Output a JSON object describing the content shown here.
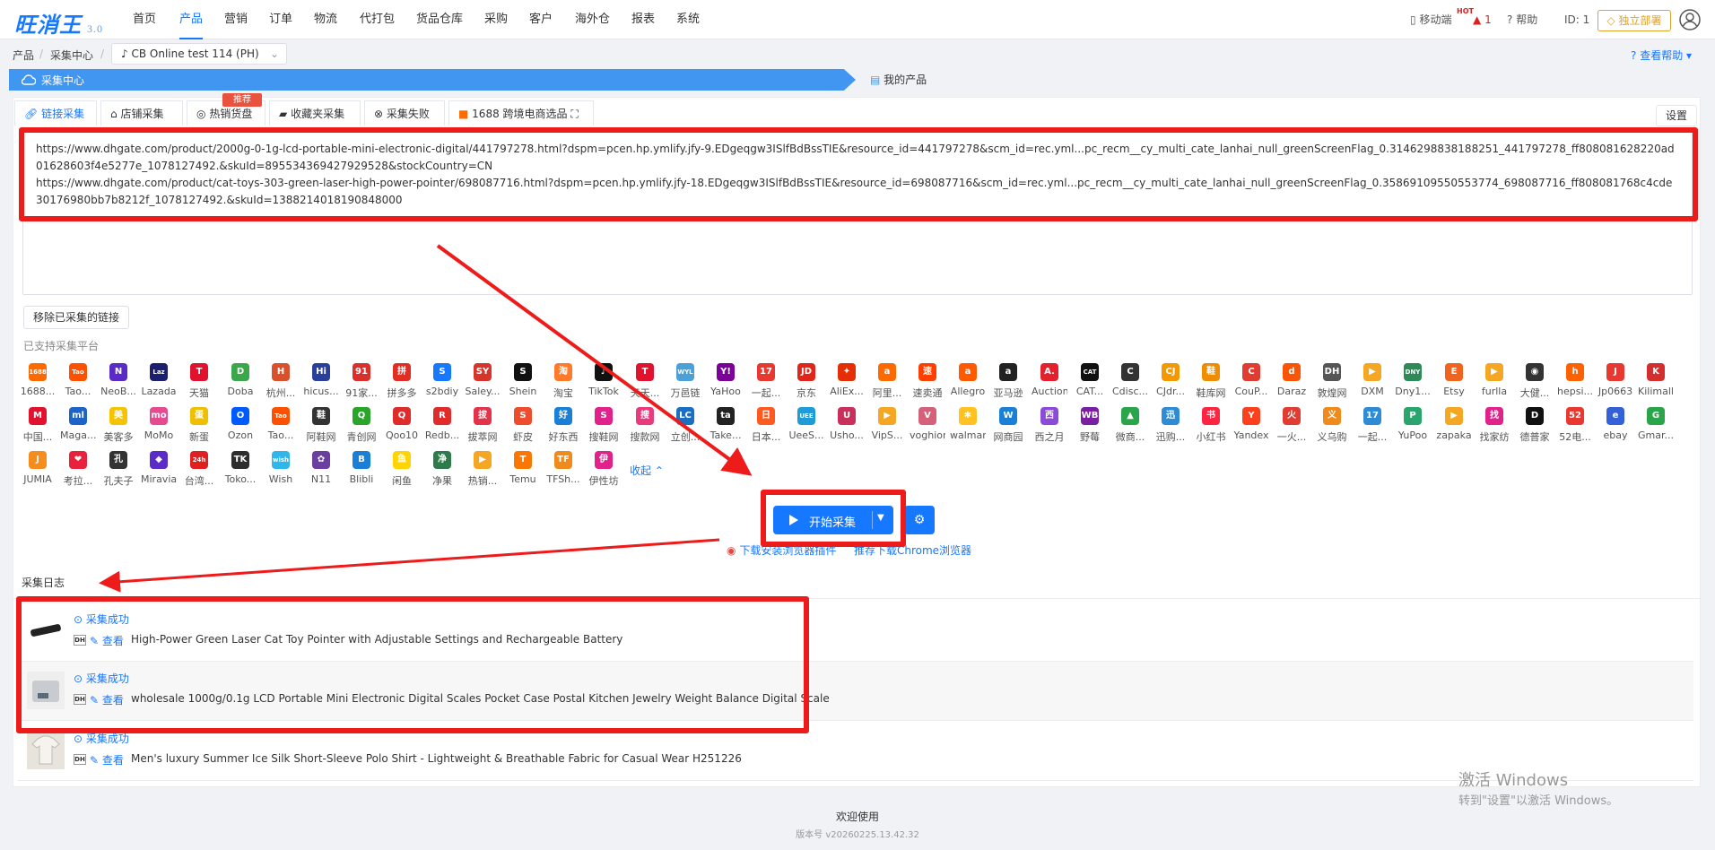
{
  "app": {
    "logo": "旺消王",
    "version": "3.0"
  },
  "nav": [
    "首页",
    "产品",
    "营销",
    "订单",
    "物流",
    "代打包",
    "货品仓库",
    "采购",
    "客户",
    "海外仓",
    "报表",
    "系统"
  ],
  "nav_active": 1,
  "topright": {
    "mobile": "移动端",
    "hot": "HOT",
    "alert_count": "1",
    "help": "帮助",
    "id": "ID: 1",
    "deploy": "独立部署"
  },
  "breadcrumb": {
    "product": "产品",
    "center": "采集中心",
    "store": "CB Online test 114 (PH)",
    "help": "查看帮助"
  },
  "bar": {
    "collect_center": "采集中心",
    "my_products": "我的产品"
  },
  "tabs": [
    "链接采集",
    "店铺采集",
    "热销货盘",
    "收藏夹采集",
    "采集失败",
    "1688 跨境电商选品"
  ],
  "tab_badge": "推荐",
  "settings": "设置",
  "urls": [
    "https://www.dhgate.com/product/2000g-0-1g-lcd-portable-mini-electronic-digital/441797278.html?dspm=pcen.hp.ymlify.jfy-9.EDgeqgw3ISlfBdBssTIE&resource_id=441797278&scm_id=rec.yml...pc_recm__cy_multi_cate_lanhai_null_greenScreenFlag_0.3146298838188251_441797278_ff808081628220ad01628603f4e5277e_1078127492.&skuId=895534369427929528&stockCountry=CN",
    "https://www.dhgate.com/product/cat-toys-303-green-laser-high-power-pointer/698087716.html?dspm=pcen.hp.ymlify.jfy-18.EDgeqgw3ISlfBdBssTIE&resource_id=698087716&scm_id=rec.yml...pc_recm__cy_multi_cate_lanhai_null_greenScreenFlag_0.35869109550553774_698087716_ff808081768c4cde30176980bb7b8212f_1078127492.&skuId=1388214018190848000"
  ],
  "remove_btn": "移除已采集的链接",
  "supported_label": "已支持采集平台",
  "platforms": [
    {
      "name": "1688...",
      "color": "#ff6a00",
      "glyph": "1688"
    },
    {
      "name": "Tao...",
      "color": "#ff5000",
      "glyph": "Tao"
    },
    {
      "name": "NeoB...",
      "color": "#5b2bc7",
      "glyph": "N"
    },
    {
      "name": "Lazada",
      "color": "#1c1f6e",
      "glyph": "Laz"
    },
    {
      "name": "天猫",
      "color": "#e0122d",
      "glyph": "T"
    },
    {
      "name": "Doba",
      "color": "#3aa84a",
      "glyph": "D"
    },
    {
      "name": "杭州...",
      "color": "#d9512c",
      "glyph": "H"
    },
    {
      "name": "hicus...",
      "color": "#2a3f9b",
      "glyph": "Hi"
    },
    {
      "name": "91家...",
      "color": "#d9302c",
      "glyph": "91"
    },
    {
      "name": "拼多多",
      "color": "#e02e24",
      "glyph": "拼"
    },
    {
      "name": "s2bdiy",
      "color": "#1677ff",
      "glyph": "S"
    },
    {
      "name": "Saley...",
      "color": "#d8352a",
      "glyph": "SY"
    },
    {
      "name": "Shein",
      "color": "#111111",
      "glyph": "S"
    },
    {
      "name": "淘宝",
      "color": "#ff7a2a",
      "glyph": "淘"
    },
    {
      "name": "TikTok",
      "color": "#111111",
      "glyph": "♪"
    },
    {
      "name": "天天...",
      "color": "#e0122d",
      "glyph": "T"
    },
    {
      "name": "万邑链",
      "color": "#4ca0d8",
      "glyph": "WYL"
    },
    {
      "name": "YaHoo",
      "color": "#7b0099",
      "glyph": "Y!"
    },
    {
      "name": "一起...",
      "color": "#e8382f",
      "glyph": "17"
    },
    {
      "name": "京东",
      "color": "#e1251b",
      "glyph": "JD"
    },
    {
      "name": "AliEx...",
      "color": "#e62e04",
      "glyph": "✦"
    },
    {
      "name": "阿里...",
      "color": "#ff6a00",
      "glyph": "a"
    },
    {
      "name": "速卖通",
      "color": "#ff4000",
      "glyph": "速"
    },
    {
      "name": "Allegro",
      "color": "#ff5a00",
      "glyph": "a"
    },
    {
      "name": "亚马逊",
      "color": "#222222",
      "glyph": "a"
    },
    {
      "name": "Auction",
      "color": "#e3202b",
      "glyph": "A."
    },
    {
      "name": "CAT...",
      "color": "#111111",
      "glyph": "CAT"
    },
    {
      "name": "Cdisc...",
      "color": "#333333",
      "glyph": "C"
    },
    {
      "name": "CJdr...",
      "color": "#f39800",
      "glyph": "CJ"
    },
    {
      "name": "鞋库网",
      "color": "#f08c00",
      "glyph": "鞋"
    },
    {
      "name": "CouP...",
      "color": "#e03c31",
      "glyph": "C"
    },
    {
      "name": "Daraz",
      "color": "#f85606",
      "glyph": "d"
    },
    {
      "name": "敦煌网",
      "color": "#555555",
      "glyph": "DH"
    },
    {
      "name": "DXM",
      "color": "#f5a623",
      "glyph": "▶"
    },
    {
      "name": "Dny1...",
      "color": "#2e8b57",
      "glyph": "DNY"
    },
    {
      "name": "Etsy",
      "color": "#f1641e",
      "glyph": "E"
    },
    {
      "name": "furlla",
      "color": "#f5a623",
      "glyph": "▶"
    },
    {
      "name": "大健...",
      "color": "#333333",
      "glyph": "◉"
    },
    {
      "name": "hepsi...",
      "color": "#ff6000",
      "glyph": "h"
    },
    {
      "name": "Jp0663",
      "color": "#e8382f",
      "glyph": "J"
    },
    {
      "name": "Kilimall",
      "color": "#d42e2e",
      "glyph": "K"
    },
    {
      "name": "中国...",
      "color": "#e0122d",
      "glyph": "M"
    },
    {
      "name": "Maga...",
      "color": "#1e63c7",
      "glyph": "ml"
    },
    {
      "name": "美客多",
      "color": "#f5c400",
      "glyph": "美"
    },
    {
      "name": "MoMo",
      "color": "#e44c8f",
      "glyph": "mo"
    },
    {
      "name": "新蛋",
      "color": "#f0c000",
      "glyph": "蛋"
    },
    {
      "name": "Ozon",
      "color": "#005bff",
      "glyph": "O"
    },
    {
      "name": "Tao...",
      "color": "#ff5000",
      "glyph": "Tao"
    },
    {
      "name": "阿鞋网",
      "color": "#333333",
      "glyph": "鞋"
    },
    {
      "name": "青创网",
      "color": "#2aa52a",
      "glyph": "Q"
    },
    {
      "name": "Qoo10",
      "color": "#e02b2b",
      "glyph": "Q"
    },
    {
      "name": "Redb...",
      "color": "#e02b2b",
      "glyph": "R"
    },
    {
      "name": "拔萃网",
      "color": "#e2334a",
      "glyph": "拔"
    },
    {
      "name": "虾皮",
      "color": "#ee4d2d",
      "glyph": "S"
    },
    {
      "name": "好东西",
      "color": "#1a7fd6",
      "glyph": "好"
    },
    {
      "name": "搜鞋网",
      "color": "#e0228a",
      "glyph": "S"
    },
    {
      "name": "搜款网",
      "color": "#e93a7e",
      "glyph": "搜"
    },
    {
      "name": "立创...",
      "color": "#1b6fc2",
      "glyph": "LC"
    },
    {
      "name": "Take...",
      "color": "#222222",
      "glyph": "ta"
    },
    {
      "name": "日本...",
      "color": "#ff5a1f",
      "glyph": "日"
    },
    {
      "name": "UeeS...",
      "color": "#1f9bd7",
      "glyph": "UEE"
    },
    {
      "name": "Usho...",
      "color": "#c8305b",
      "glyph": "U"
    },
    {
      "name": "VipS...",
      "color": "#f5a623",
      "glyph": "▶"
    },
    {
      "name": "voghion",
      "color": "#d4607a",
      "glyph": "V"
    },
    {
      "name": "walmart",
      "color": "#ffc220",
      "glyph": "✱"
    },
    {
      "name": "网商园",
      "color": "#1a7fd6",
      "glyph": "W"
    },
    {
      "name": "西之月",
      "color": "#8a4cd6",
      "glyph": "西"
    },
    {
      "name": "野莓",
      "color": "#7a1fa2",
      "glyph": "WB"
    },
    {
      "name": "微商...",
      "color": "#2aa54a",
      "glyph": "▲"
    },
    {
      "name": "迅购...",
      "color": "#2e8bd6",
      "glyph": "迅"
    },
    {
      "name": "小红书",
      "color": "#ff2442",
      "glyph": "书"
    },
    {
      "name": "Yandex",
      "color": "#fc3f1d",
      "glyph": "Y"
    },
    {
      "name": "一火...",
      "color": "#e03c31",
      "glyph": "火"
    },
    {
      "name": "义乌购",
      "color": "#f08a1c",
      "glyph": "义"
    },
    {
      "name": "一起...",
      "color": "#2e8bd6",
      "glyph": "17"
    },
    {
      "name": "YuPoo",
      "color": "#2aa56e",
      "glyph": "P"
    },
    {
      "name": "zapaka",
      "color": "#f5a623",
      "glyph": "▶"
    },
    {
      "name": "找家纺",
      "color": "#e0228a",
      "glyph": "找"
    },
    {
      "name": "德普家",
      "color": "#111111",
      "glyph": "D"
    },
    {
      "name": "52电...",
      "color": "#e8382f",
      "glyph": "52"
    },
    {
      "name": "ebay",
      "color": "#3561d8",
      "glyph": "e"
    },
    {
      "name": "Gmar...",
      "color": "#2aa54a",
      "glyph": "G"
    },
    {
      "name": "JUMIA",
      "color": "#f68b1e",
      "glyph": "J"
    },
    {
      "name": "考拉...",
      "color": "#e8213c",
      "glyph": "❤"
    },
    {
      "name": "孔夫子",
      "color": "#333333",
      "glyph": "孔"
    },
    {
      "name": "Miravia",
      "color": "#5b2bc7",
      "glyph": "◆"
    },
    {
      "name": "台湾...",
      "color": "#e02020",
      "glyph": "24h"
    },
    {
      "name": "Toko...",
      "color": "#2d2d2d",
      "glyph": "TK"
    },
    {
      "name": "Wish",
      "color": "#2fb7ec",
      "glyph": "wish"
    },
    {
      "name": "N11",
      "color": "#6b3fa0",
      "glyph": "✿"
    },
    {
      "name": "Blibli",
      "color": "#1a7fd6",
      "glyph": "B"
    },
    {
      "name": "闲鱼",
      "color": "#ffd400",
      "glyph": "鱼"
    },
    {
      "name": "净果",
      "color": "#2f7a4a",
      "glyph": "净"
    },
    {
      "name": "热销...",
      "color": "#f5a623",
      "glyph": "▶"
    },
    {
      "name": "Temu",
      "color": "#fb7701",
      "glyph": "T"
    },
    {
      "name": "TFSh...",
      "color": "#ef8a1c",
      "glyph": "TF"
    },
    {
      "name": "伊性坊",
      "color": "#e0228a",
      "glyph": "伊"
    }
  ],
  "collapse": "收起",
  "start_btn": "开始采集",
  "chrome": {
    "plugin": "下载安装浏览器插件",
    "recommend": "推荐下载Chrome浏览器"
  },
  "log_header": "采集日志",
  "logs": [
    {
      "status": "采集成功",
      "view": "查看",
      "title": "High-Power Green Laser Cat Toy Pointer with Adjustable Settings and Rechargeable Battery"
    },
    {
      "status": "采集成功",
      "view": "查看",
      "title": "wholesale 1000g/0.1g LCD Portable Mini Electronic Digital Scales Pocket Case Postal Kitchen Jewelry Weight Balance Digital Scale"
    },
    {
      "status": "采集成功",
      "view": "查看",
      "title": "Men's luxury Summer Ice Silk Short-Sleeve Polo Shirt - Lightweight & Breathable Fabric for Casual Wear H251226"
    }
  ],
  "dh_tag": "DH",
  "watermark": {
    "line1": "激活 Windows",
    "line2": "转到\"设置\"以激活 Windows。"
  },
  "footer": {
    "welcome": "欢迎使用",
    "version": "版本号 v20260225.13.42.32"
  },
  "colors": {
    "accent": "#1677ff",
    "annotation_red": "#ee1b1b",
    "bar_blue": "#4196f2"
  }
}
